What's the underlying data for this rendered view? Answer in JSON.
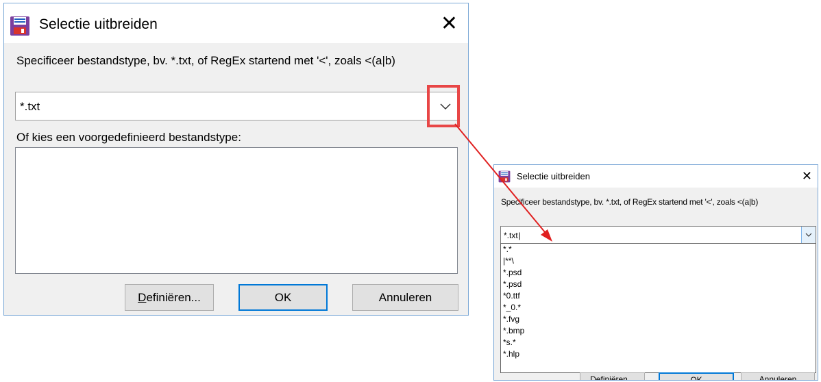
{
  "main_dialog": {
    "title": "Selectie uitbreiden",
    "close_glyph": "✕",
    "prompt": "Specificeer bestandstype, bv. *.txt, of RegEx startend met '<', zoals <(a|b)",
    "combo_value": "*.txt",
    "predefined_label": "Of kies een voorgedefinieerd bestandstype:",
    "buttons": {
      "define_first_letter": "D",
      "define_rest": "efiniëren...",
      "ok": "OK",
      "cancel": "Annuleren"
    }
  },
  "popup_dialog": {
    "title": "Selectie uitbreiden",
    "close_glyph": "✕",
    "prompt": "Specificeer bestandstype, bv. *.txt, of RegEx startend met '<', zoals <(a|b)",
    "combo_value": "*.txt",
    "dropdown_items": [
      "*.*",
      "|**\\",
      "*.psd",
      "*.psd",
      "*0.ttf",
      "*_0.*",
      "*.fvg",
      "*.bmp",
      "*s.*",
      "*.hlp"
    ],
    "buttons": {
      "define": "Definiëren...",
      "ok": "OK",
      "cancel": "Annuleren"
    }
  },
  "colors": {
    "highlight": "#e84646",
    "arrow": "#e02020",
    "focus_border": "#0078d7",
    "dialog_bg": "#f0f0f0"
  }
}
